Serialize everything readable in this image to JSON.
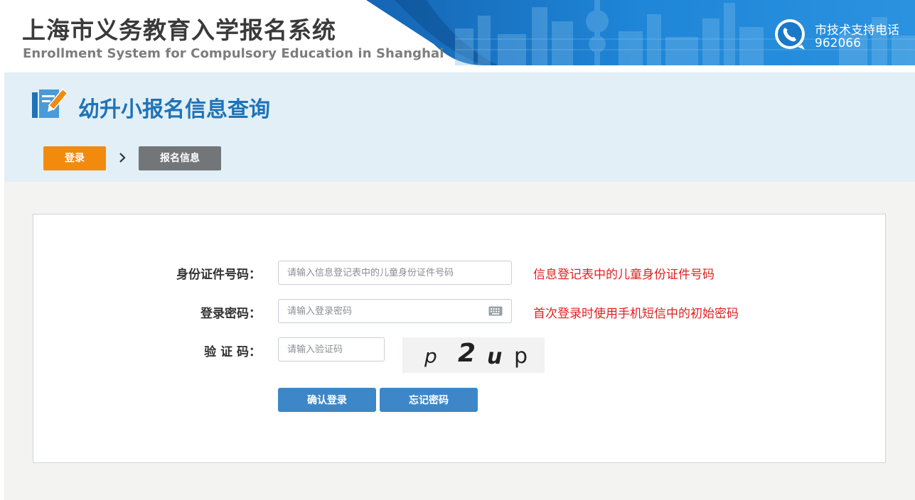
{
  "header": {
    "title": "上海市义务教育入学报名系统",
    "subtitle": "Enrollment System for Compulsory Education in Shanghai",
    "support_label": "市技术支持电话",
    "support_number": "962066",
    "support_icon": "phone-icon",
    "banner_color": "#1a78c8"
  },
  "page": {
    "title": "幼升小报名信息查询",
    "title_icon": "edit-form-icon",
    "title_color": "#1f73b7"
  },
  "steps": [
    {
      "label": "登录",
      "active": true,
      "color": "#f28a0e"
    },
    {
      "label": "报名信息",
      "active": false,
      "color": "#737679"
    }
  ],
  "form": {
    "id_number": {
      "label": "身份证件号码：",
      "placeholder": "请输入信息登记表中的儿童身份证件号码",
      "value": "",
      "hint": "信息登记表中的儿童身份证件号码"
    },
    "password": {
      "label": "登录密码：",
      "placeholder": "请输入登录密码",
      "value": "",
      "hint": "首次登录时使用手机短信中的初始密码",
      "icon": "keyboard-icon"
    },
    "captcha": {
      "label": "验 证 码：",
      "placeholder": "请输入验证码",
      "value": "",
      "image_text": [
        "p",
        "2",
        "u",
        "p"
      ]
    },
    "buttons": {
      "login": "确认登录",
      "forgot": "忘记密码"
    },
    "hint_color": "#e02020",
    "button_color": "#3d87c8"
  }
}
